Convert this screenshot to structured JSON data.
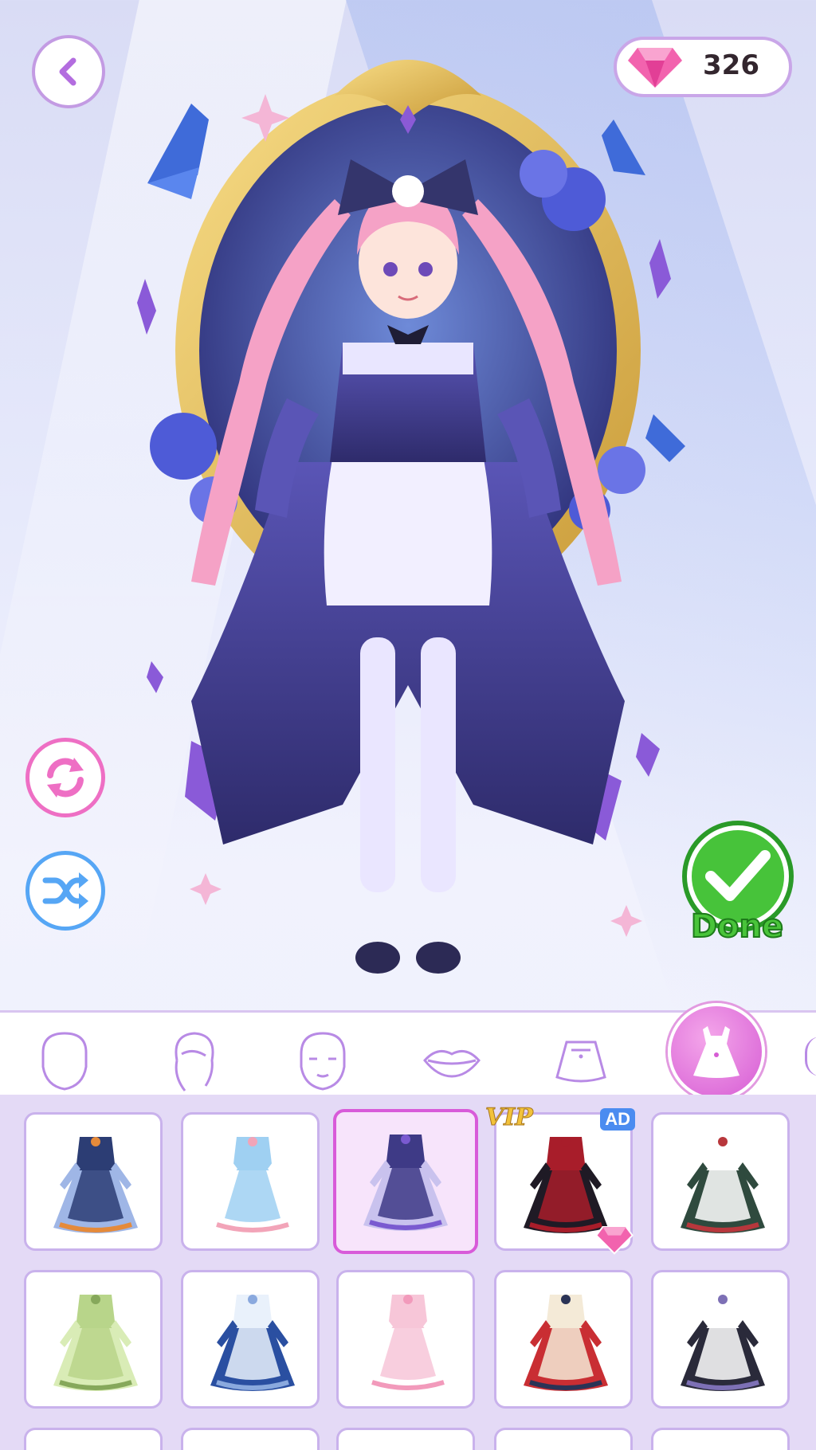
{
  "header": {
    "back_icon": "chevron-left-icon",
    "gem_icon": "pink-gem-icon",
    "gem_count": "326"
  },
  "left_controls": {
    "reset_icon": "refresh-icon",
    "random_icon": "shuffle-icon"
  },
  "done_button": {
    "label": "Done",
    "icon": "checkmark-icon"
  },
  "category_tabs": [
    {
      "name": "face-shape",
      "icon": "face-outline-icon",
      "selected": false
    },
    {
      "name": "hair",
      "icon": "hair-icon",
      "selected": false
    },
    {
      "name": "face-features",
      "icon": "face-features-icon",
      "selected": false
    },
    {
      "name": "mouth",
      "icon": "lips-icon",
      "selected": false
    },
    {
      "name": "skirt",
      "icon": "skirt-icon",
      "selected": false
    },
    {
      "name": "dress",
      "icon": "dress-icon",
      "selected": true
    }
  ],
  "badges": {
    "vip": "VIP",
    "ad": "AD"
  },
  "outfits": [
    {
      "row": 1,
      "col": 1,
      "colors": [
        "#2c3d74",
        "#9fb6e6",
        "#e58a3a"
      ],
      "selected": false
    },
    {
      "row": 1,
      "col": 2,
      "colors": [
        "#9fd0f2",
        "#ffffff",
        "#f2a4b8"
      ],
      "selected": false
    },
    {
      "row": 1,
      "col": 3,
      "colors": [
        "#3e3a86",
        "#c9c2ee",
        "#7a5ad0"
      ],
      "selected": true
    },
    {
      "row": 1,
      "col": 4,
      "colors": [
        "#a81d2a",
        "#1f1a25",
        "#a81d2a"
      ],
      "selected": false,
      "badge": "vip",
      "price_icon": "pink-gem-icon",
      "ad_badge": true
    },
    {
      "row": 1,
      "col": 5,
      "colors": [
        "#ffffff",
        "#2f4a3e",
        "#b8373c"
      ],
      "selected": false
    },
    {
      "row": 2,
      "col": 1,
      "colors": [
        "#b8d58a",
        "#d9ecb6",
        "#86a85b"
      ],
      "selected": false
    },
    {
      "row": 2,
      "col": 2,
      "colors": [
        "#e9f1fb",
        "#2a4fa1",
        "#8aa9de"
      ],
      "selected": false
    },
    {
      "row": 2,
      "col": 3,
      "colors": [
        "#f7c6d8",
        "#ffffff",
        "#f29abb"
      ],
      "selected": false
    },
    {
      "row": 2,
      "col": 4,
      "colors": [
        "#f4ead7",
        "#c92e33",
        "#2a3356"
      ],
      "selected": false
    },
    {
      "row": 2,
      "col": 5,
      "colors": [
        "#ffffff",
        "#2a2a3a",
        "#7d70b5"
      ],
      "selected": false
    }
  ],
  "colors": {
    "accent_pink": "#ee6fc4",
    "accent_blue": "#56a6f5",
    "accent_purple": "#b36ddf",
    "done_green": "#47c33a"
  }
}
